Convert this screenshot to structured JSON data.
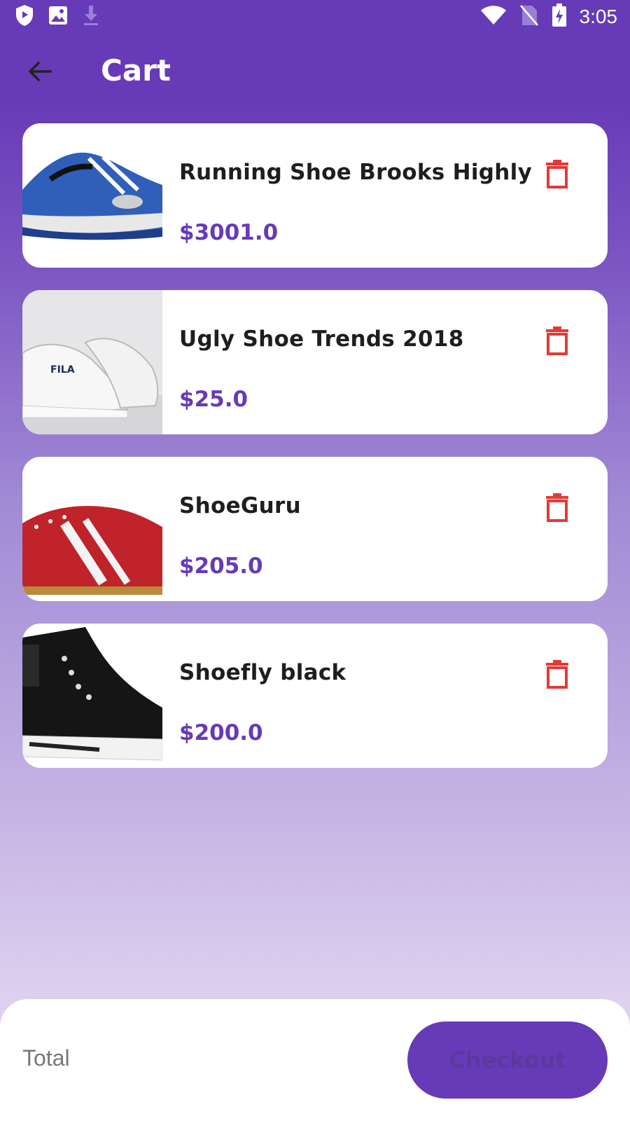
{
  "status_bar": {
    "time": "3:05",
    "left_icons": [
      "shield-icon",
      "image-icon",
      "download-icon"
    ],
    "right_icons": [
      "wifi-icon",
      "no-sim-icon",
      "battery-charging-icon"
    ]
  },
  "app_bar": {
    "title": "Cart",
    "back_icon": "arrow-left-icon"
  },
  "cart": {
    "items": [
      {
        "name": "Running Shoe Brooks Highly",
        "price": "$3001.0",
        "image": "blue-running-shoe"
      },
      {
        "name": "Ugly Shoe Trends 2018",
        "price": "$25.0",
        "image": "white-fila-sneakers"
      },
      {
        "name": "ShoeGuru",
        "price": "$205.0",
        "image": "red-white-sneaker"
      },
      {
        "name": "Shoefly black",
        "price": "$200.0",
        "image": "black-high-top-sneaker"
      }
    ],
    "delete_icon": "trash-icon"
  },
  "footer": {
    "total_label": "Total",
    "checkout_label": "Checkout"
  },
  "colors": {
    "primary": "#673AB7",
    "delete": "#E53935",
    "text": "#1e1e1e"
  }
}
